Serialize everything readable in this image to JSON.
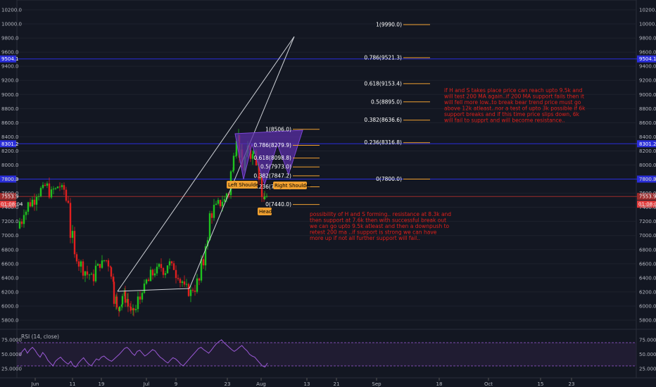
{
  "chart_data": {
    "type": "candlestick",
    "price_axis": {
      "min": 5700,
      "max": 10300,
      "ticks": [
        "10200.0",
        "10000.0",
        "9800.0",
        "9600.0",
        "9400.0",
        "9200.0",
        "9000.0",
        "8800.0",
        "8600.0",
        "8400.0",
        "8200.0",
        "8000.0",
        "7800.0",
        "7600.0",
        "7400.0",
        "7200.0",
        "7000.0",
        "6800.0",
        "6600.0",
        "6400.0",
        "6200.0",
        "6000.0",
        "5800.0"
      ],
      "tick_values": [
        10200,
        10000,
        9800,
        9600,
        9400,
        9200,
        9000,
        8800,
        8600,
        8400,
        8200,
        8000,
        7800,
        7600,
        7400,
        7200,
        7000,
        6800,
        6600,
        6400,
        6200,
        6000,
        5800
      ]
    },
    "time_axis": {
      "labels": [
        "Jun",
        "11",
        "19",
        "Jul",
        "9",
        "23",
        "Aug",
        "13",
        "21",
        "Sep",
        "18",
        "Oct",
        "15",
        "23"
      ]
    },
    "horizontal_levels": [
      {
        "price": 9504.1,
        "label": "9504.1",
        "color": "#2a2ed9"
      },
      {
        "price": 8301.2,
        "label": "8301.2",
        "color": "#2a2ed9"
      },
      {
        "price": 7800.3,
        "label": "7800.3",
        "color": "#2a2ed9"
      },
      {
        "price": 7553.9,
        "label": "7553.9",
        "color": "#9c2b2b"
      }
    ],
    "current_price": {
      "value": "7553.9",
      "countdown": "01:08:04",
      "color": "#e03b3b"
    },
    "fib_right": [
      {
        "ratio": "1(9990.0)",
        "price": 9990.0
      },
      {
        "ratio": "0.786(9521.3)",
        "price": 9521.3
      },
      {
        "ratio": "0.618(9153.4)",
        "price": 9153.4
      },
      {
        "ratio": "0.5(8895.0)",
        "price": 8895.0
      },
      {
        "ratio": "0.382(8636.6)",
        "price": 8636.6
      },
      {
        "ratio": "0.236(8316.8)",
        "price": 8316.8
      },
      {
        "ratio": "0(7800.0)",
        "price": 7800.0
      }
    ],
    "fib_left": [
      {
        "ratio": "1(8506.0)",
        "price": 8506.0
      },
      {
        "ratio": "0.786(8279.9)",
        "price": 8279.9
      },
      {
        "ratio": "0.618(8098.8)",
        "price": 8098.8
      },
      {
        "ratio": "0.5(7973.0)",
        "price": 7973.0
      },
      {
        "ratio": "0.382(7847.2)",
        "price": 7847.2
      },
      {
        "ratio": "0.236(7691.1)",
        "price": 7691.1
      },
      {
        "ratio": "0(7440.0)",
        "price": 7440.0
      }
    ],
    "pattern_labels": {
      "left_shoulder": "Left Shoulder",
      "right_shoulder": "Right Shoulder",
      "head": "Head"
    },
    "notes": {
      "upper": [
        "if H and S takes place price can reach upto 9.5k and",
        "will test 200 MA again..if 200 MA support fails then it",
        "will fell more low..to break bear trend price must go",
        "above 12k atleast..nor a test of upto 3k possible if 6k",
        "support breaks and if this time price slips down, 6k",
        "will fail to supprt and will become resistance.."
      ],
      "lower": [
        "possibility of H and S forming.. resistance at 8.3k and",
        "then support at 7.6k then with successful break out",
        "we can go upto 9.5k atleast and then a downpush to",
        "retest 200 ma ..if support is strong we can have",
        "more up if not all further support will fail.."
      ]
    },
    "rsi": {
      "title": "RSI (14, close)",
      "ticks": [
        "75.0000",
        "50.0000",
        "25.0000"
      ],
      "tick_values": [
        75,
        50,
        25
      ],
      "upper_band": 70,
      "lower_band": 30,
      "values": [
        48,
        55,
        60,
        52,
        58,
        62,
        57,
        50,
        45,
        53,
        48,
        40,
        35,
        30,
        38,
        42,
        45,
        40,
        36,
        33,
        38,
        30,
        28,
        35,
        40,
        44,
        38,
        33,
        30,
        36,
        42,
        40,
        45,
        47,
        43,
        40,
        38,
        42,
        46,
        50,
        55,
        60,
        62,
        58,
        52,
        48,
        55,
        57,
        52,
        47,
        50,
        54,
        58,
        56,
        50,
        45,
        42,
        38,
        35,
        40,
        44,
        42,
        38,
        33,
        30,
        35,
        40,
        45,
        50,
        55,
        60,
        62,
        58,
        55,
        52,
        57,
        63,
        68,
        72,
        75,
        70,
        66,
        62,
        58,
        55,
        58,
        62,
        65,
        60,
        56,
        50,
        47,
        45,
        40,
        35,
        30,
        28,
        35
      ]
    },
    "colors": {
      "background": "#131722",
      "up": "#1fc21f",
      "down": "#e01f1f",
      "pattern_fill": "#5a2fa6",
      "fib_line": "#f0a030",
      "rsi_line": "#9b59d6"
    }
  }
}
